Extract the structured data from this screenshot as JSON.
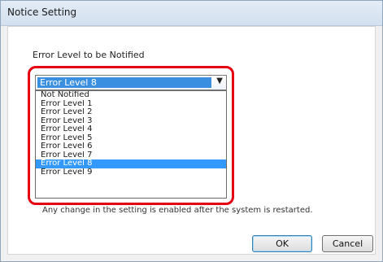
{
  "window": {
    "title": "Notice Setting"
  },
  "form": {
    "label": "Error Level to be Notified",
    "selected_value": "Error Level 8",
    "options": [
      "Not Notified",
      "Error Level 1",
      "Error Level 2",
      "Error Level 3",
      "Error Level 4",
      "Error Level 5",
      "Error Level 6",
      "Error Level 7",
      "Error Level 8",
      "Error Level 9"
    ],
    "selected_index": 8,
    "note": "Any change in the setting is enabled after the system is restarted."
  },
  "buttons": {
    "ok": "OK",
    "cancel": "Cancel"
  },
  "icons": {
    "dropdown": "chevron-down-icon"
  },
  "colors": {
    "highlight_ring": "#e60012",
    "selection": "#3399ff"
  }
}
